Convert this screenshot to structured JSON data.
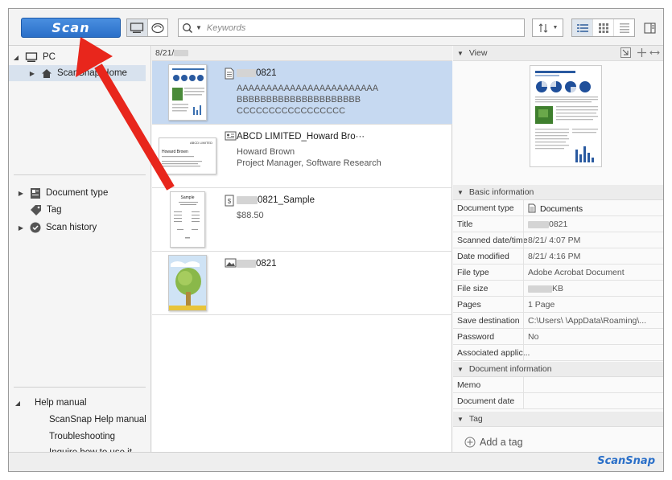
{
  "toolbar": {
    "scan_label": "Scan",
    "search_placeholder": "Keywords"
  },
  "sidebar": {
    "pc_label": "PC",
    "scansnap_home_label": "ScanSnap Home",
    "document_type_label": "Document type",
    "tag_label": "Tag",
    "scan_history_label": "Scan history",
    "help_manual_label": "Help manual",
    "help_items": [
      "ScanSnap Help manual",
      "Troubleshooting",
      "Inquire how to use it"
    ]
  },
  "list": {
    "date_header": "8/21/",
    "items": [
      {
        "title": "0821",
        "lines": [
          "AAAAAAAAAAAAAAAAAAAAAAAA",
          "BBBBBBBBBBBBBBBBBBBBB",
          "CCCCCCCCCCCCCCCCC"
        ],
        "icon": "document-icon"
      },
      {
        "title": "ABCD LIMITED_Howard Bro···",
        "lines": [
          "Howard Brown",
          "Project Manager, Software Research"
        ],
        "icon": "business-card-icon"
      },
      {
        "title": "0821_Sample",
        "lines": [
          "$88.50"
        ],
        "icon": "receipt-icon"
      },
      {
        "title": "0821",
        "lines": [],
        "icon": "photo-icon"
      }
    ],
    "card_thumb": {
      "company": "ABCD LIMITED",
      "name": "Howard Brown"
    },
    "receipt_thumb": {
      "title": "Sample"
    }
  },
  "details": {
    "view_label": "View",
    "basic_info_label": "Basic information",
    "rows": [
      {
        "key": "Document type",
        "value": "Documents"
      },
      {
        "key": "Title",
        "value": "0821"
      },
      {
        "key": "Scanned date/time",
        "value": "8/21/      4:07 PM"
      },
      {
        "key": "Date modified",
        "value": "8/21/      4:16 PM"
      },
      {
        "key": "File type",
        "value": "Adobe Acrobat Document"
      },
      {
        "key": "File size",
        "value": "KB"
      },
      {
        "key": "Pages",
        "value": "1 Page"
      },
      {
        "key": "Save destination",
        "value": "C:\\Users\\            \\AppData\\Roaming\\..."
      },
      {
        "key": "Password",
        "value": "No"
      },
      {
        "key": "Associated applic...",
        "value": ""
      }
    ],
    "document_info_label": "Document information",
    "doc_rows": [
      {
        "key": "Memo",
        "value": ""
      },
      {
        "key": "Document date",
        "value": ""
      }
    ],
    "tag_section_label": "Tag",
    "add_tag_label": "Add a tag"
  },
  "statusbar": {
    "brand": "ScanSnap"
  },
  "colors": {
    "accent": "#2a6fc8",
    "selection": "#c6d9f1",
    "arrow": "#e8261c"
  }
}
